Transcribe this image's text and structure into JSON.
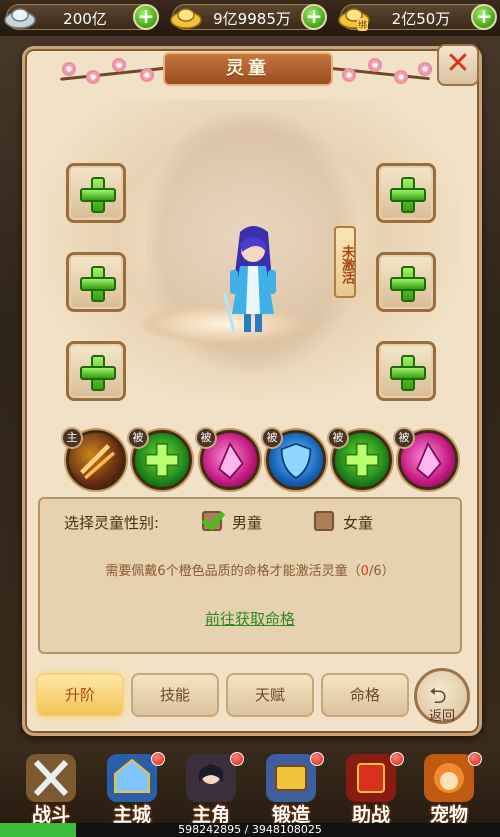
{
  "currency": {
    "silver": "200亿",
    "gold": "9亿9985万",
    "bound_gold": "2亿50万",
    "bound_gold_badge": "绑"
  },
  "panel": {
    "title": "灵童",
    "inactive_tag": "未激活"
  },
  "skills": [
    {
      "tag": "主",
      "type": "gold",
      "icon": "blades-icon"
    },
    {
      "tag": "被",
      "type": "green",
      "icon": "heal-cross-icon"
    },
    {
      "tag": "被",
      "type": "pink",
      "icon": "crystal-icon"
    },
    {
      "tag": "被",
      "type": "blue",
      "icon": "shield-icon"
    },
    {
      "tag": "被",
      "type": "green",
      "icon": "heal-cross-icon"
    },
    {
      "tag": "被",
      "type": "pink",
      "icon": "crystal-icon"
    }
  ],
  "gender": {
    "label": "选择灵童性别:",
    "male": "男童",
    "female": "女童",
    "selected": "male"
  },
  "requirement": {
    "prefix": "需要佩戴6个橙色品质的命格才能激活灵童（",
    "count": "0",
    "suffix": "/6）"
  },
  "goto_link": "前往获取命格",
  "tabs": [
    "升阶",
    "技能",
    "天赋",
    "命格"
  ],
  "back_label": "返回",
  "bottom_nav": [
    {
      "label": "战斗",
      "icon": "crossed-swords-icon"
    },
    {
      "label": "主城",
      "icon": "castle-icon"
    },
    {
      "label": "主角",
      "icon": "hero-portrait-icon"
    },
    {
      "label": "锻造",
      "icon": "forge-icon"
    },
    {
      "label": "助战",
      "icon": "scroll-icon"
    },
    {
      "label": "宠物",
      "icon": "monkey-pet-icon"
    }
  ],
  "exp": {
    "text": "598242895 / 3948108025",
    "fraction": 0.1515
  },
  "colors": {
    "accent_green": "#3ea315",
    "count_red": "#e53a14",
    "link_green": "#2f8a21"
  }
}
